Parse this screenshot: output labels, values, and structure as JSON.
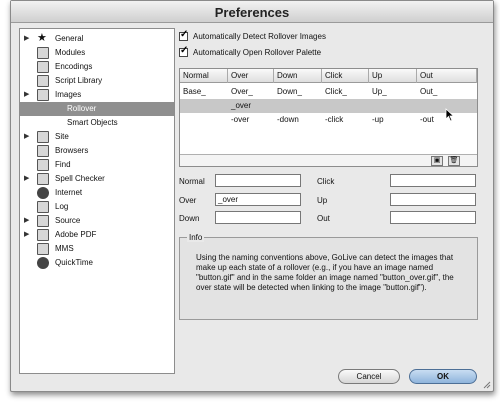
{
  "window": {
    "title": "Preferences"
  },
  "sidebar": {
    "items": [
      {
        "label": "General",
        "icon": "star-icon",
        "expander": true,
        "sub": false,
        "selected": false
      },
      {
        "label": "Modules",
        "icon": "modules-icon",
        "expander": false,
        "sub": false,
        "selected": false
      },
      {
        "label": "Encodings",
        "icon": "encodings-icon",
        "expander": false,
        "sub": false,
        "selected": false
      },
      {
        "label": "Script Library",
        "icon": "script-library-icon",
        "expander": false,
        "sub": false,
        "selected": false
      },
      {
        "label": "Images",
        "icon": "images-icon",
        "expander": true,
        "sub": false,
        "selected": false
      },
      {
        "label": "Rollover",
        "icon": "",
        "expander": false,
        "sub": true,
        "selected": true
      },
      {
        "label": "Smart Objects",
        "icon": "",
        "expander": false,
        "sub": true,
        "selected": false
      },
      {
        "label": "Site",
        "icon": "site-icon",
        "expander": true,
        "sub": false,
        "selected": false
      },
      {
        "label": "Browsers",
        "icon": "browsers-icon",
        "expander": false,
        "sub": false,
        "selected": false
      },
      {
        "label": "Find",
        "icon": "find-icon",
        "expander": false,
        "sub": false,
        "selected": false
      },
      {
        "label": "Spell Checker",
        "icon": "spell-checker-icon",
        "expander": true,
        "sub": false,
        "selected": false
      },
      {
        "label": "Internet",
        "icon": "internet-icon",
        "expander": false,
        "sub": false,
        "selected": false
      },
      {
        "label": "Log",
        "icon": "log-icon",
        "expander": false,
        "sub": false,
        "selected": false
      },
      {
        "label": "Source",
        "icon": "source-icon",
        "expander": true,
        "sub": false,
        "selected": false
      },
      {
        "label": "Adobe PDF",
        "icon": "adobe-pdf-icon",
        "expander": true,
        "sub": false,
        "selected": false
      },
      {
        "label": "MMS",
        "icon": "mms-icon",
        "expander": false,
        "sub": false,
        "selected": false
      },
      {
        "label": "QuickTime",
        "icon": "quicktime-icon",
        "expander": false,
        "sub": false,
        "selected": false
      }
    ]
  },
  "options": {
    "auto_detect": {
      "label": "Automatically Detect Rollover Images",
      "checked": true
    },
    "auto_open": {
      "label": "Automatically Open Rollover Palette",
      "checked": true
    }
  },
  "table": {
    "columns": [
      "Normal",
      "Over",
      "Down",
      "Click",
      "Up",
      "Out"
    ],
    "rows": [
      [
        "Base_",
        "Over_",
        "Down_",
        "Click_",
        "Up_",
        "Out_"
      ],
      [
        "",
        "_over",
        "",
        "",
        "",
        ""
      ],
      [
        "",
        "-over",
        "-down",
        "-click",
        "-up",
        "-out"
      ]
    ],
    "selected_row": 1
  },
  "fields": {
    "normal": {
      "label": "Normal",
      "value": ""
    },
    "over": {
      "label": "Over",
      "value": "_over"
    },
    "down": {
      "label": "Down",
      "value": ""
    },
    "click": {
      "label": "Click",
      "value": ""
    },
    "up": {
      "label": "Up",
      "value": ""
    },
    "out": {
      "label": "Out",
      "value": ""
    }
  },
  "info": {
    "title": "Info",
    "text": "Using the naming conventions above, GoLive can detect the images that make up each state of a rollover (e.g., if you have an image named \"button.gif\" and in the same folder an image named \"button_over.gif\", the over state will be detected when linking to the image \"button.gif\")."
  },
  "buttons": {
    "cancel": "Cancel",
    "ok": "OK"
  },
  "colors": {
    "selection": "#8f8f8f",
    "row_selection": "#c8c8c8",
    "default_button": "#8fb4dc"
  }
}
